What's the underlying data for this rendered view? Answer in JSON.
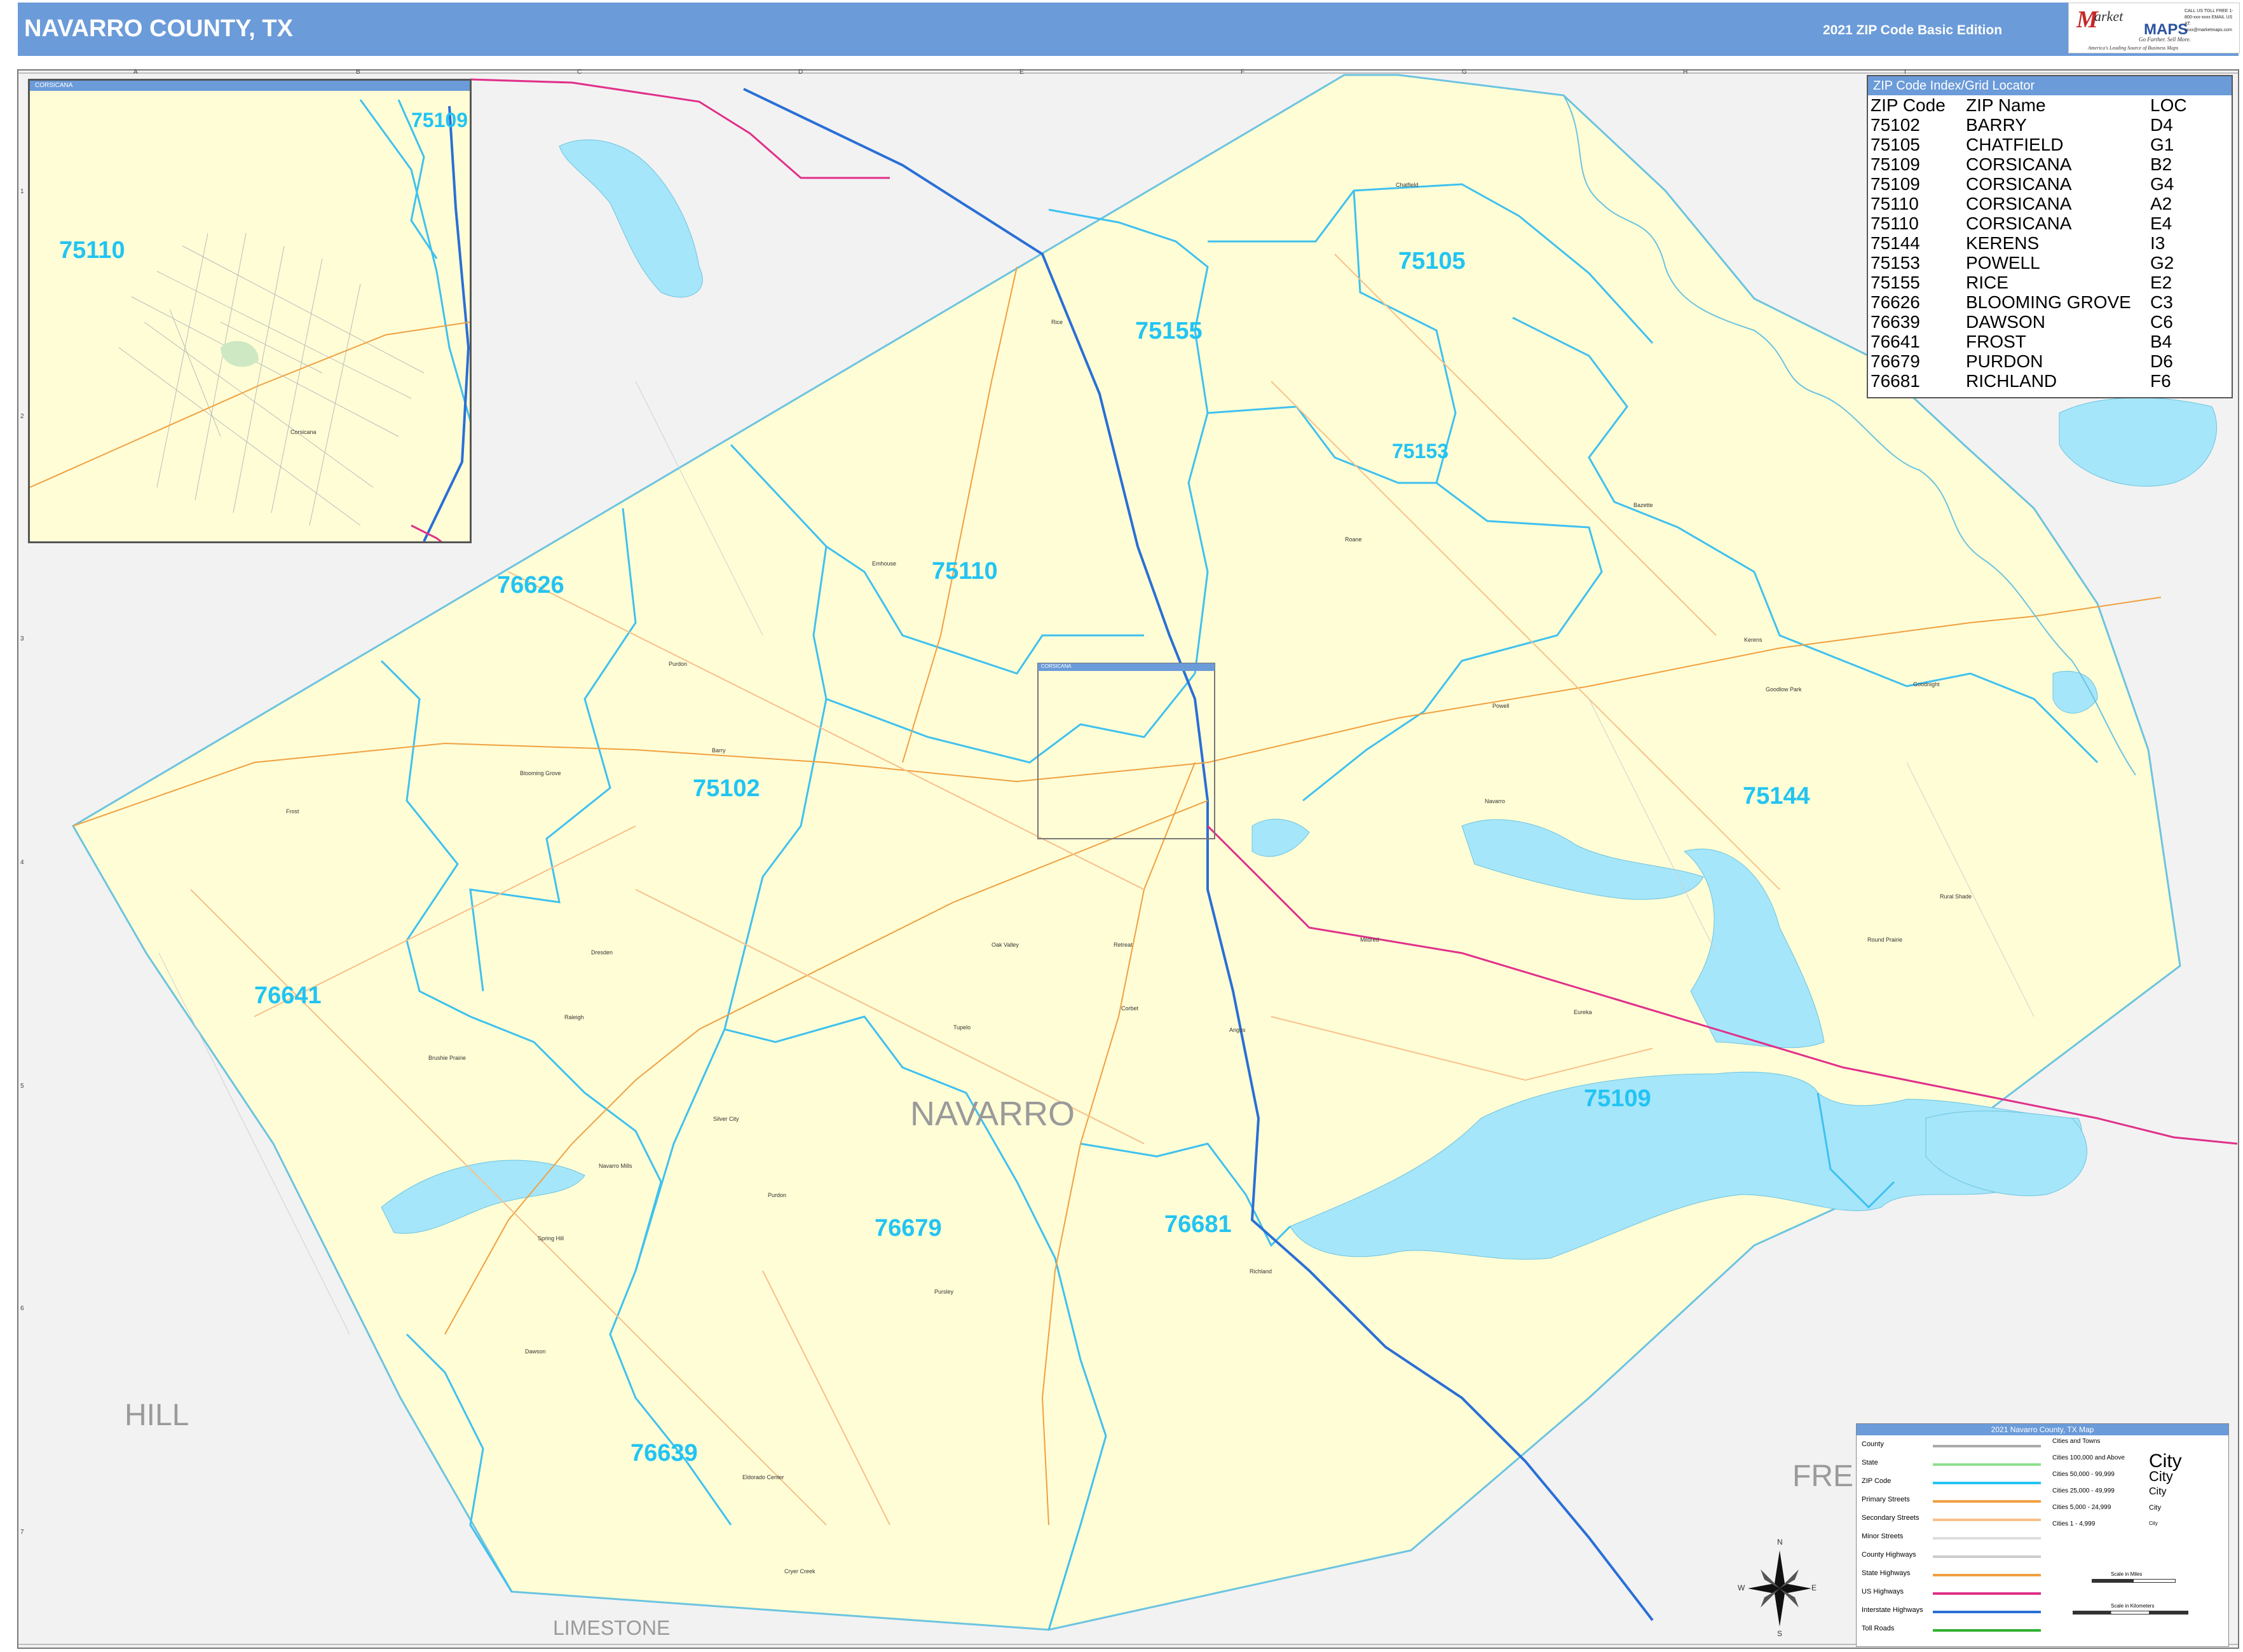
{
  "header": {
    "title": "NAVARRO COUNTY, TX",
    "edition": "2021 ZIP Code Basic Edition"
  },
  "logo": {
    "brand_m": "M",
    "brand_arket": "arket",
    "brand_maps": "MAPS",
    "tagline": "Go Farther. Sell More.",
    "tagline2": "America's Leading Source of Business Maps",
    "contact": "CALL US TOLL FREE 1-800-xxx-xxxx EMAIL US AT: xxxx@marketmaps.com"
  },
  "map": {
    "county_name": "NAVARRO",
    "neighbors": [
      "HILL",
      "LIMESTONE",
      "FRE"
    ],
    "zip_labels": [
      {
        "zip": "75105"
      },
      {
        "zip": "75155"
      },
      {
        "zip": "75153"
      },
      {
        "zip": "76626"
      },
      {
        "zip": "75110"
      },
      {
        "zip": "75102"
      },
      {
        "zip": "75144"
      },
      {
        "zip": "76641"
      },
      {
        "zip": "75109"
      },
      {
        "zip": "76679"
      },
      {
        "zip": "76681"
      },
      {
        "zip": "76639"
      }
    ],
    "places": [
      "Chatfield",
      "Rice",
      "Barry",
      "Blooming Grove",
      "Frost",
      "Dresden",
      "Oak Valley",
      "Retreat",
      "Purdon",
      "Dawson",
      "Richland",
      "Kerens",
      "Powell",
      "Emhouse",
      "Navarro Mills",
      "Spring Hill",
      "Eldorado Center",
      "Goodlow Park",
      "Angus",
      "Mildred",
      "Eureka",
      "Rural Shade",
      "Round Prairie",
      "Silver City",
      "Tupelo",
      "Corbet",
      "Roane",
      "Pursley",
      "Bazette",
      "Goodnight",
      "Emmett",
      "Purdon",
      "Cryer Creek",
      "Rodney",
      "Navarro",
      "Elm Flat",
      "Raleigh",
      "Pelham",
      "Brushie Prairie"
    ],
    "grid_columns": [
      "A",
      "B",
      "C",
      "D",
      "E",
      "F",
      "G",
      "H",
      "I"
    ],
    "grid_rows": [
      "1",
      "2",
      "3",
      "4",
      "5",
      "6",
      "7"
    ]
  },
  "inset": {
    "title": "CORSICANA",
    "zip_a": "75109",
    "zip_b": "75110",
    "place": "Corsicana",
    "locator_label": "CORSICANA"
  },
  "zip_index": {
    "title": "ZIP Code Index/Grid Locator",
    "headers": [
      "ZIP Code",
      "ZIP Name",
      "LOC"
    ],
    "rows": [
      [
        "75102",
        "BARRY",
        "D4"
      ],
      [
        "75105",
        "CHATFIELD",
        "G1"
      ],
      [
        "75109",
        "CORSICANA",
        "B2"
      ],
      [
        "75109",
        "CORSICANA",
        "G4"
      ],
      [
        "75110",
        "CORSICANA",
        "A2"
      ],
      [
        "75110",
        "CORSICANA",
        "E4"
      ],
      [
        "75144",
        "KERENS",
        "I3"
      ],
      [
        "75153",
        "POWELL",
        "G2"
      ],
      [
        "75155",
        "RICE",
        "E2"
      ],
      [
        "76626",
        "BLOOMING GROVE",
        "C3"
      ],
      [
        "76639",
        "DAWSON",
        "C6"
      ],
      [
        "76641",
        "FROST",
        "B4"
      ],
      [
        "76679",
        "PURDON",
        "D6"
      ],
      [
        "76681",
        "RICHLAND",
        "F6"
      ]
    ]
  },
  "legend": {
    "title": "2021 Navarro County, TX Map",
    "items": [
      "County",
      "State",
      "ZIP Code",
      "Primary Streets",
      "Secondary Streets",
      "Minor Streets",
      "County Highways",
      "State Highways",
      "US Highways",
      "Interstate Highways",
      "Toll Roads"
    ],
    "cities_heading": "Cities and Towns",
    "city_classes": [
      "Cities 100,000 and Above",
      "Cities 50,000 - 99,999",
      "Cities 25,000 - 49,999",
      "Cities 5,000 - 24,999",
      "Cities 1 - 4,999"
    ],
    "city_samples": [
      "City",
      "City",
      "City",
      "City",
      "City"
    ],
    "scale_miles": "Scale in Miles",
    "scale_km": "Scale in Kilometers",
    "colors": {
      "county": "#aaaaaa",
      "state": "#8ee08e",
      "zip": "#22c4f2",
      "primary": "#f0a040",
      "secondary": "#f7c08a",
      "minor": "#dddddd",
      "county_hwy": "#cccccc",
      "state_hwy": "#f0a040",
      "us_hwy": "#e0308a",
      "interstate": "#2a6fd6",
      "toll": "#30b030"
    }
  },
  "compass": {
    "n": "N",
    "s": "S",
    "e": "E",
    "w": "W"
  }
}
